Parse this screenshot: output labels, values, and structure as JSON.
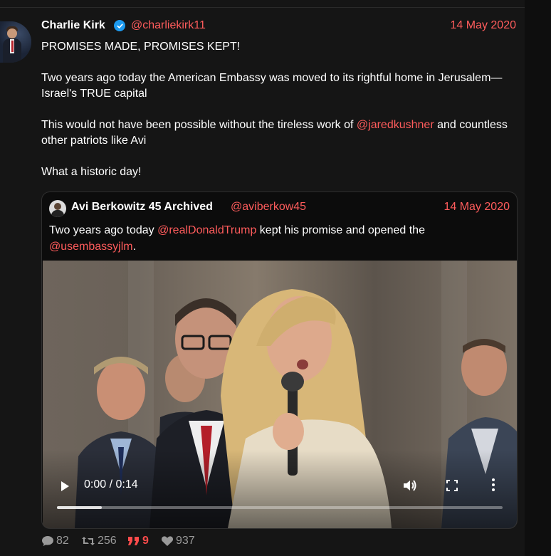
{
  "post": {
    "author_name": "Charlie Kirk",
    "author_handle": "@charliekirk11",
    "date": "14 May 2020",
    "line1": "PROMISES MADE, PROMISES KEPT!",
    "line2": "Two years ago today the American Embassy was moved to its rightful home in Jerusalem—Israel's TRUE capital",
    "line3_before": "This would not have been possible without the tireless work of ",
    "line3_mention": "@jaredkushner",
    "line3_after": " and countless other patriots like Avi",
    "line4": "What a historic day!"
  },
  "quoted": {
    "author_name": "Avi Berkowitz 45 Archived",
    "author_handle": "@aviberkow45",
    "date": "14 May 2020",
    "text_before": "Two years ago today ",
    "mention1": "@realDonaldTrump",
    "text_middle": " kept his promise and opened the ",
    "mention2": "@usembassyjlm",
    "text_after": "."
  },
  "video": {
    "time": "0:00 / 0:14",
    "progress": 0.1
  },
  "stats": {
    "replies": "82",
    "reposts": "256",
    "quotes": "9",
    "likes": "937"
  },
  "colors": {
    "accent": "#ff5c5c",
    "verified": "#1d9bf0",
    "background": "#151515"
  },
  "icons": [
    "verified-icon",
    "play-icon",
    "volume-icon",
    "fullscreen-icon",
    "more-vert-icon",
    "comment-icon",
    "retweet-icon",
    "quote-icon",
    "heart-icon"
  ]
}
